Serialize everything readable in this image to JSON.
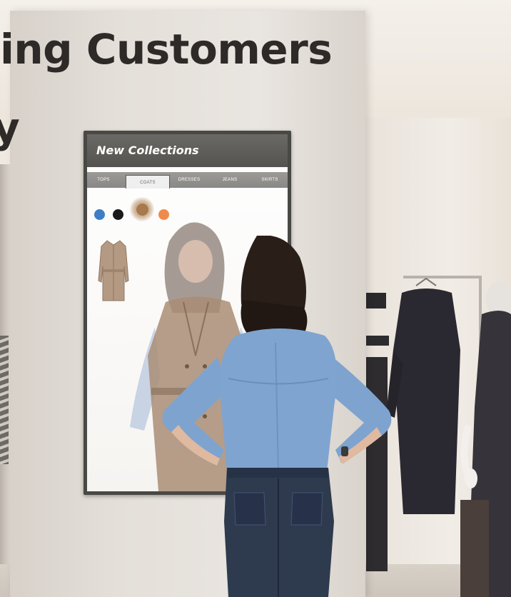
{
  "headline": {
    "line1": "ing Customers",
    "line2": "y"
  },
  "display": {
    "title": "New Collections",
    "tabs": [
      "TOPS",
      "COATS",
      "DRESSES",
      "JEANS",
      "SKIRTS"
    ],
    "active_tab": "COATS",
    "swatches": [
      {
        "name": "blue",
        "color": "#3f7ec6"
      },
      {
        "name": "black",
        "color": "#1a1a1a"
      },
      {
        "name": "tan",
        "color": "#a67a4e"
      },
      {
        "name": "orange",
        "color": "#f08a4b"
      }
    ]
  },
  "colors": {
    "headline": "#2d2a27",
    "display_header": "#5f5d5a",
    "shirt": "#7ea3cf",
    "jeans": "#2e3a4e",
    "coat": "#b59a82"
  },
  "icons": [
    "coat-thumbnail",
    "reflection-person",
    "clothing-rack",
    "mannequin"
  ]
}
